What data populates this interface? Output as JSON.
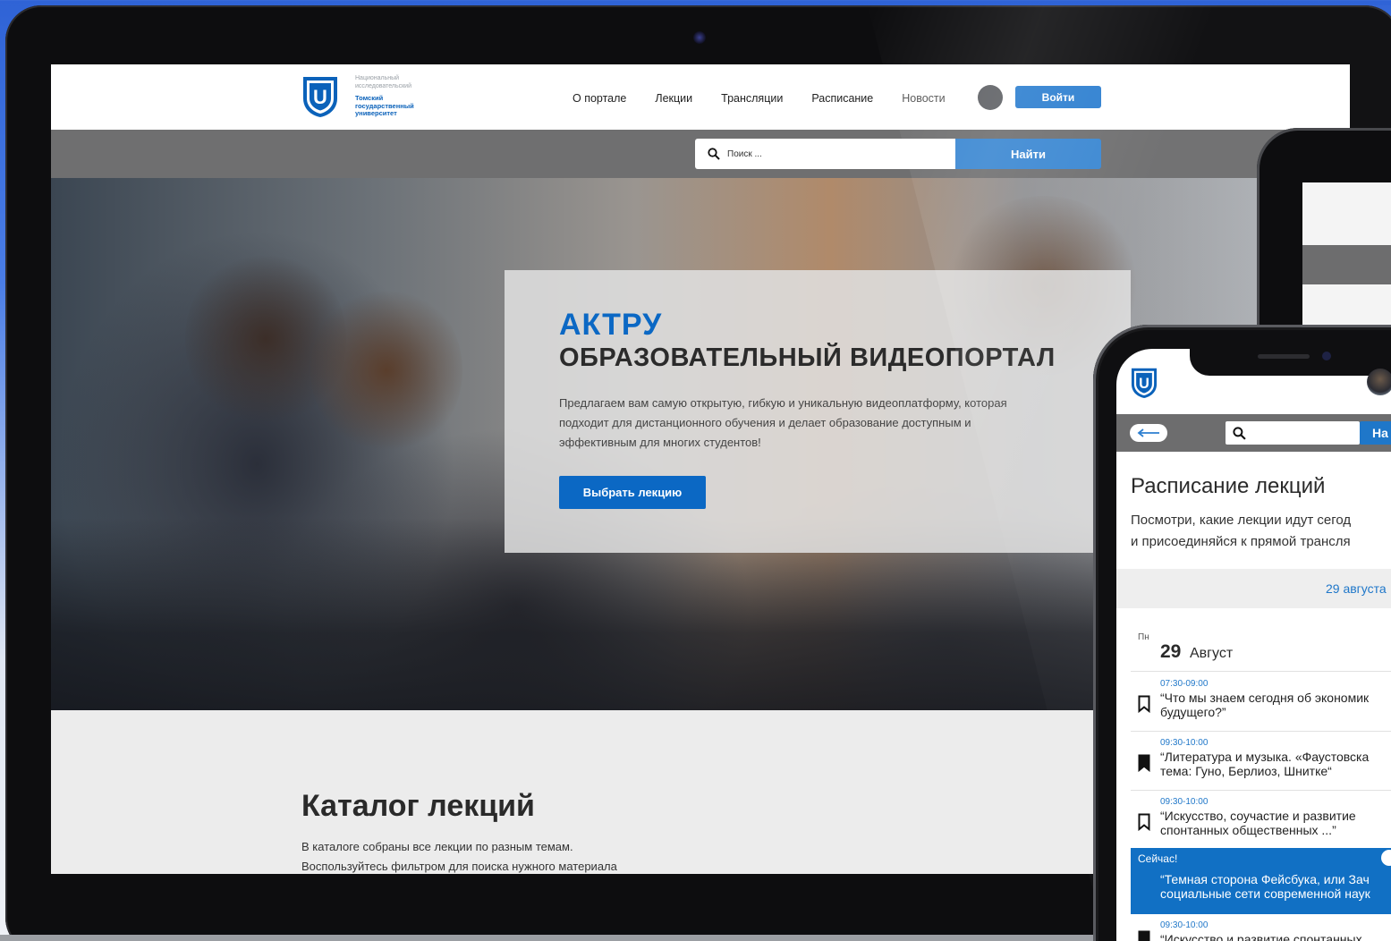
{
  "colors": {
    "accent": "#0b68c4",
    "button_blue": "#2d7fd0",
    "band_gray": "#6f6f70",
    "now_blue": "#1170c4"
  },
  "site": {
    "logo": {
      "letter": "U",
      "line1": "Национальный",
      "line2": "исследовательский",
      "line3": "Томский",
      "line4": "государственный",
      "line5": "университет"
    },
    "nav": [
      {
        "label": "О портале"
      },
      {
        "label": "Лекции"
      },
      {
        "label": "Трансляции"
      },
      {
        "label": "Расписание"
      },
      {
        "label": "Новости"
      }
    ],
    "login_label": "Войти",
    "search": {
      "placeholder": "Поиск ...",
      "button_label": "Найти",
      "icon": "search-icon"
    },
    "hero": {
      "title_brand": "АКТРУ",
      "title_main": "ОБРАЗОВАТЕЛЬНЫЙ ВИДЕОПОРТАЛ",
      "description": "Предлагаем вам самую открытую, гибкую и уникальную видеоплатформу, которая подходит для дистанционного обучения и делает образование доступным и эффективным для многих студентов!",
      "cta_label": "Выбрать лекцию"
    },
    "catalog": {
      "title": "Каталог лекций",
      "desc_line1": "В каталоге собраны все лекции по разным темам.",
      "desc_line2": "Воспользуйтесь фильтром для поиска нужного материала"
    }
  },
  "phone": {
    "logo_letter": "U",
    "back_icon": "arrow-left-icon",
    "search_button_label": "На",
    "title": "Расписание лекций",
    "subtitle_line1": "Посмотри, какие лекции идут сегод",
    "subtitle_line2": "и присоединяйся к прямой трансля",
    "date_link": "29 августа",
    "day": {
      "weekday": "Пн",
      "number": "29",
      "month": "Август"
    },
    "items": [
      {
        "time": "07:30-09:00",
        "line1": "“Что мы знаем сегодня об экономик",
        "line2": "будущего?”",
        "bookmarked": false
      },
      {
        "time": "09:30-10:00",
        "line1": "“Литература и музыка. «Фаустовска",
        "line2": "тема: Гуно, Берлиоз, Шнитке“",
        "bookmarked": true
      },
      {
        "time": "09:30-10:00",
        "line1": "“Искусство, соучастие и развитие",
        "line2": "спонтанных общественных ...”",
        "bookmarked": false
      }
    ],
    "now": {
      "label": "Сейчас!",
      "line1": "“Темная сторона Фейсбука, или Зач",
      "line2": "социальные сети современной наук"
    },
    "last_item": {
      "time": "09:30-10:00",
      "line1": "“Искусство и развитие спонтанных"
    }
  }
}
